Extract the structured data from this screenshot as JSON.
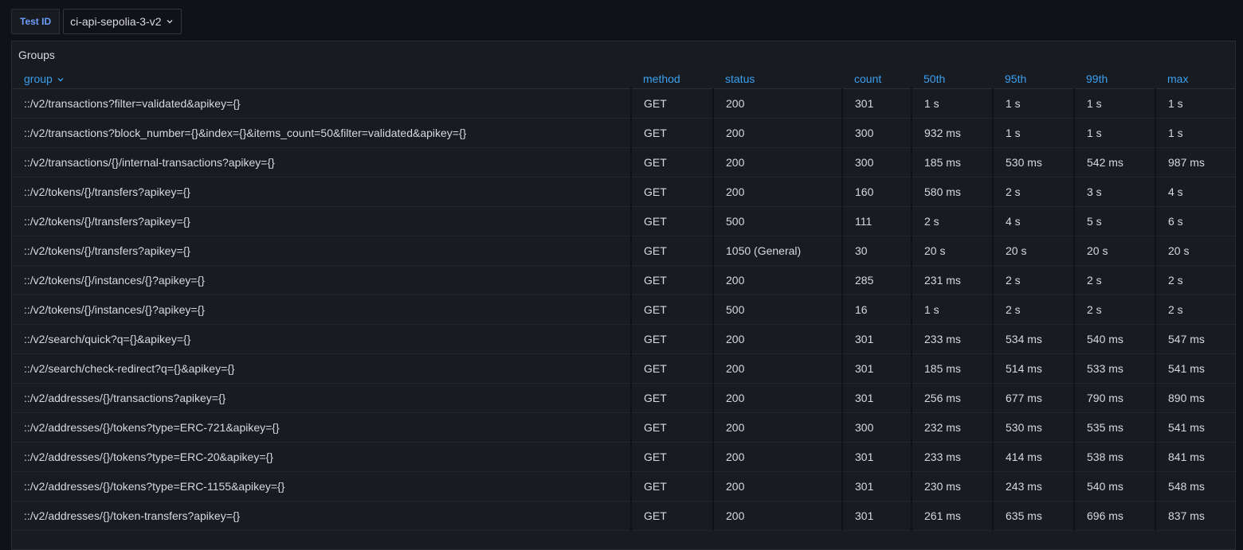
{
  "variable": {
    "label": "Test ID",
    "value": "ci-api-sepolia-3-v2",
    "chevron_icon": "chevron-down-icon"
  },
  "panel": {
    "title": "Groups",
    "columns": [
      "group",
      "method",
      "status",
      "count",
      "50th",
      "95th",
      "99th",
      "max"
    ],
    "sorted_column": "group",
    "sort_icon": "chevron-down-icon",
    "rows": [
      [
        "::/v2/transactions?filter=validated&apikey={}",
        "GET",
        "200",
        "301",
        "1 s",
        "1 s",
        "1 s",
        "1 s"
      ],
      [
        "::/v2/transactions?block_number={}&index={}&items_count=50&filter=validated&apikey={}",
        "GET",
        "200",
        "300",
        "932 ms",
        "1 s",
        "1 s",
        "1 s"
      ],
      [
        "::/v2/transactions/{}/internal-transactions?apikey={}",
        "GET",
        "200",
        "300",
        "185 ms",
        "530 ms",
        "542 ms",
        "987 ms"
      ],
      [
        "::/v2/tokens/{}/transfers?apikey={}",
        "GET",
        "200",
        "160",
        "580 ms",
        "2 s",
        "3 s",
        "4 s"
      ],
      [
        "::/v2/tokens/{}/transfers?apikey={}",
        "GET",
        "500",
        "111",
        "2 s",
        "4 s",
        "5 s",
        "6 s"
      ],
      [
        "::/v2/tokens/{}/transfers?apikey={}",
        "GET",
        "1050 (General)",
        "30",
        "20 s",
        "20 s",
        "20 s",
        "20 s"
      ],
      [
        "::/v2/tokens/{}/instances/{}?apikey={}",
        "GET",
        "200",
        "285",
        "231 ms",
        "2 s",
        "2 s",
        "2 s"
      ],
      [
        "::/v2/tokens/{}/instances/{}?apikey={}",
        "GET",
        "500",
        "16",
        "1 s",
        "2 s",
        "2 s",
        "2 s"
      ],
      [
        "::/v2/search/quick?q={}&apikey={}",
        "GET",
        "200",
        "301",
        "233 ms",
        "534 ms",
        "540 ms",
        "547 ms"
      ],
      [
        "::/v2/search/check-redirect?q={}&apikey={}",
        "GET",
        "200",
        "301",
        "185 ms",
        "514 ms",
        "533 ms",
        "541 ms"
      ],
      [
        "::/v2/addresses/{}/transactions?apikey={}",
        "GET",
        "200",
        "301",
        "256 ms",
        "677 ms",
        "790 ms",
        "890 ms"
      ],
      [
        "::/v2/addresses/{}/tokens?type=ERC-721&apikey={}",
        "GET",
        "200",
        "300",
        "232 ms",
        "530 ms",
        "535 ms",
        "541 ms"
      ],
      [
        "::/v2/addresses/{}/tokens?type=ERC-20&apikey={}",
        "GET",
        "200",
        "301",
        "233 ms",
        "414 ms",
        "538 ms",
        "841 ms"
      ],
      [
        "::/v2/addresses/{}/tokens?type=ERC-1155&apikey={}",
        "GET",
        "200",
        "301",
        "230 ms",
        "243 ms",
        "540 ms",
        "548 ms"
      ],
      [
        "::/v2/addresses/{}/token-transfers?apikey={}",
        "GET",
        "200",
        "301",
        "261 ms",
        "635 ms",
        "696 ms",
        "837 ms"
      ]
    ]
  },
  "colors": {
    "background": "#111217",
    "panel": "#181b1f",
    "header_text": "#3aa0f0",
    "label_text": "#6e9fff",
    "body_text": "#d8d9e0"
  }
}
